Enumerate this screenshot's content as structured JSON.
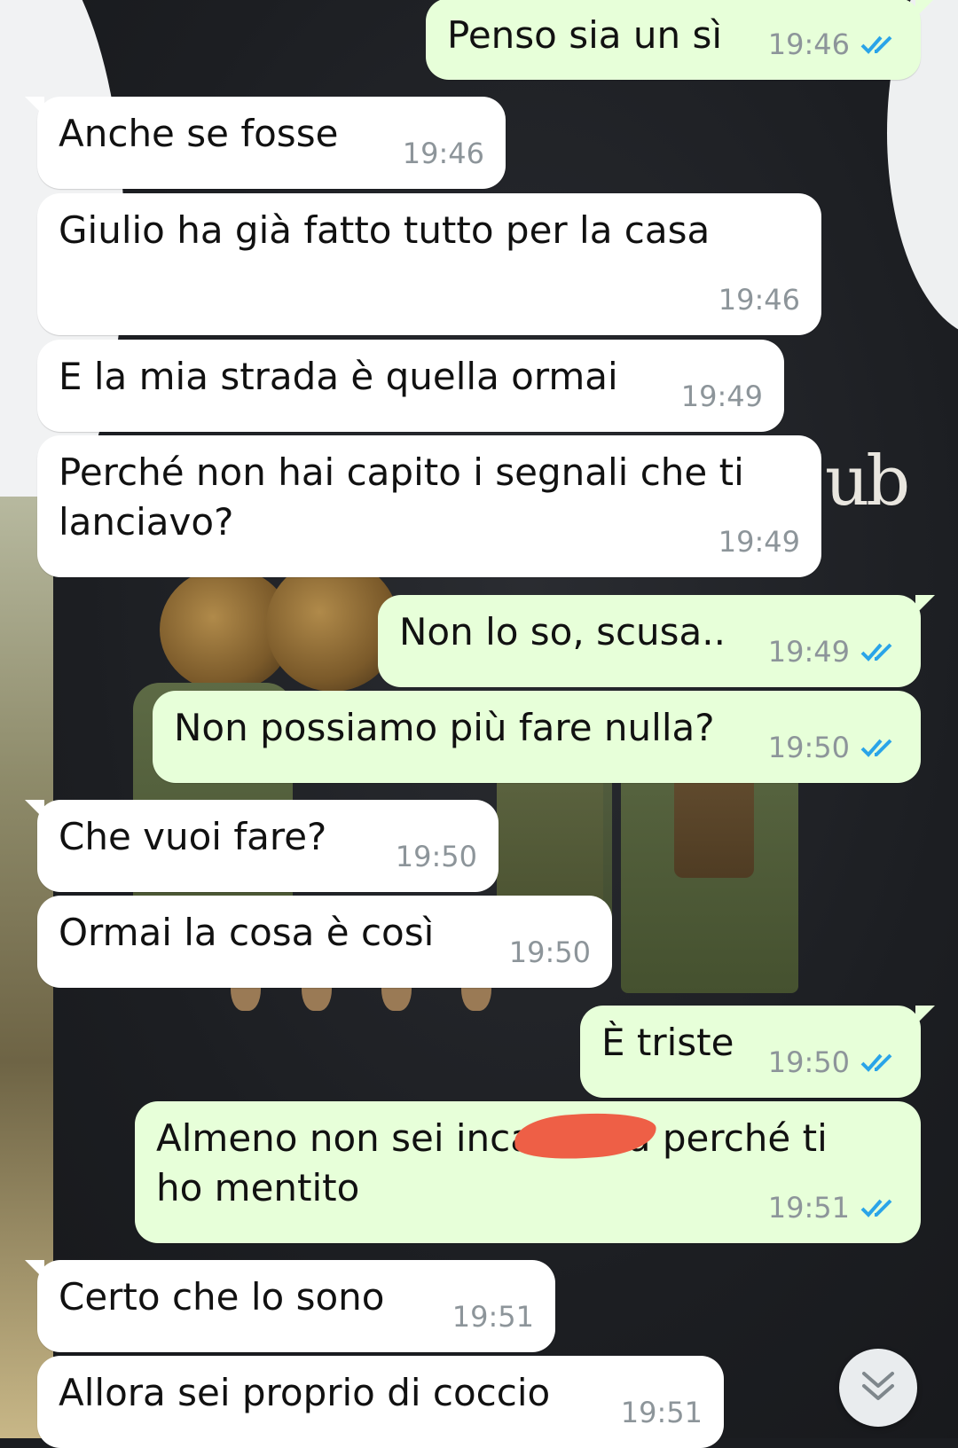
{
  "colors": {
    "incoming_bubble": "#ffffff",
    "outgoing_bubble": "#e7ffd9",
    "read_ticks": "#2aa4e8",
    "timestamp": "#8d959a",
    "redaction": "#ee5f46"
  },
  "messages": [
    {
      "dir": "out",
      "text": "Penso sia un sì",
      "time": "19:46",
      "status": "read"
    },
    {
      "dir": "in",
      "text": "Anche se fosse",
      "time": "19:46"
    },
    {
      "dir": "in",
      "text": "Giulio ha già fatto tutto per la casa",
      "time": "19:46"
    },
    {
      "dir": "in",
      "text": "E la mia strada è quella ormai",
      "time": "19:49"
    },
    {
      "dir": "in",
      "text": "Perché non hai capito i segnali che ti lanciavo?",
      "time": "19:49"
    },
    {
      "dir": "out",
      "text": "Non lo so, scusa..",
      "time": "19:49",
      "status": "read"
    },
    {
      "dir": "out",
      "text": "Non possiamo più fare nulla?",
      "time": "19:50",
      "status": "read"
    },
    {
      "dir": "in",
      "text": "Che vuoi fare?",
      "time": "19:50"
    },
    {
      "dir": "in",
      "text": "Ormai la cosa è così",
      "time": "19:50"
    },
    {
      "dir": "out",
      "text": "È triste",
      "time": "19:50",
      "status": "read"
    },
    {
      "dir": "out",
      "text": "Almeno non sei inca        a perché ti ho mentito",
      "time": "19:51",
      "status": "read",
      "redacted": true
    },
    {
      "dir": "in",
      "text": "Certo che lo sono",
      "time": "19:51"
    },
    {
      "dir": "in",
      "text": "Allora sei proprio di coccio",
      "time": "19:51"
    }
  ],
  "wallpaper": {
    "visible_text": "ub"
  },
  "scroll_button": {
    "icon": "double-chevron-down-icon"
  }
}
